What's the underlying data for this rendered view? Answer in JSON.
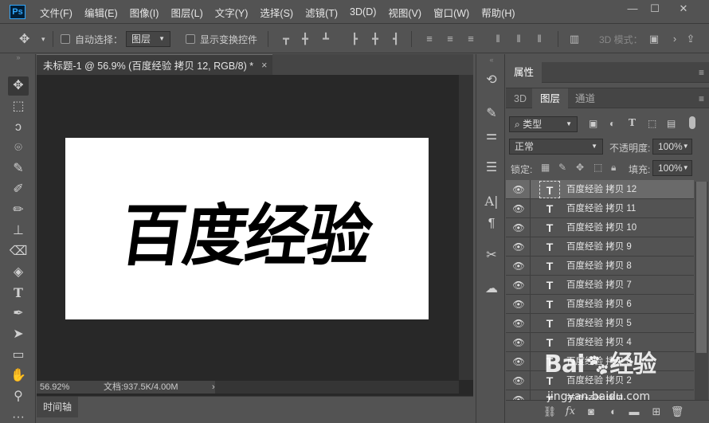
{
  "app": {
    "logo": "Ps"
  },
  "menu": [
    "文件(F)",
    "编辑(E)",
    "图像(I)",
    "图层(L)",
    "文字(Y)",
    "选择(S)",
    "滤镜(T)",
    "3D(D)",
    "视图(V)",
    "窗口(W)",
    "帮助(H)"
  ],
  "window_controls": {
    "minimize": "—",
    "maximize": "☐",
    "close": "✕"
  },
  "options": {
    "auto_select_label": "自动选择：",
    "auto_select_value": "图层",
    "transform_label": "显示变换控件",
    "mode_3d_label": "3D 模式："
  },
  "document": {
    "tab_title": "未标题-1 @ 56.9% (百度经验 拷贝 12, RGB/8) *",
    "close": "×",
    "canvas_text": "百度经验",
    "zoom": "56.92%",
    "doc_size": "文档:937.5K/4.00M",
    "status_arrow": "›"
  },
  "timeline": {
    "label": "时间轴"
  },
  "properties": {
    "tab": "属性"
  },
  "layers_panel": {
    "tabs": [
      "3D",
      "图层",
      "通道"
    ],
    "active_tab": "图层",
    "filter_label": "类型",
    "blend_mode": "正常",
    "opacity_label": "不透明度:",
    "opacity_value": "100%",
    "lock_label": "锁定:",
    "fill_label": "填充:",
    "fill_value": "100%",
    "layers": [
      {
        "name": "百度经验 拷贝 12",
        "selected": true
      },
      {
        "name": "百度经验 拷贝 11"
      },
      {
        "name": "百度经验 拷贝 10"
      },
      {
        "name": "百度经验 拷贝 9"
      },
      {
        "name": "百度经验 拷贝 8"
      },
      {
        "name": "百度经验 拷贝 7"
      },
      {
        "name": "百度经验 拷贝 6"
      },
      {
        "name": "百度经验 拷贝 5"
      },
      {
        "name": "百度经验 拷贝 4"
      },
      {
        "name": "百度经验 拷贝 3"
      },
      {
        "name": "百度经验 拷贝 2"
      },
      {
        "name": "百度经验 拷贝"
      }
    ]
  },
  "watermark": {
    "brand_left": "Bai",
    "brand_right": "经验",
    "url": "jingyan.baidu.com"
  }
}
